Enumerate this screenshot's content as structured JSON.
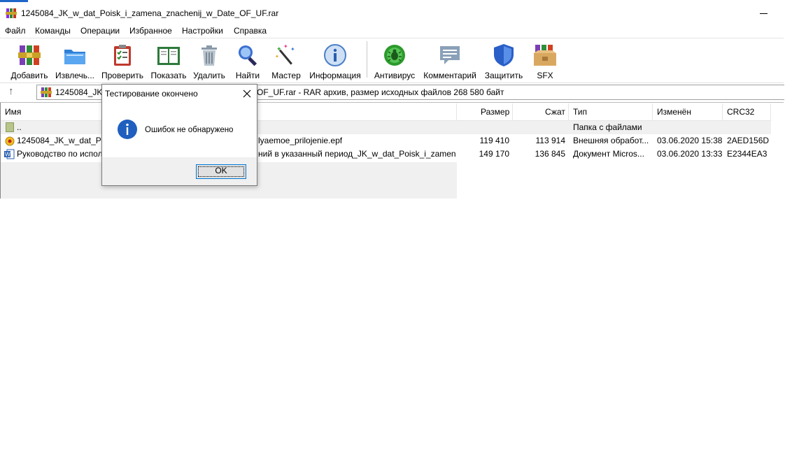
{
  "window": {
    "title": "1245084_JK_w_dat_Poisk_i_zamena_znachenij_w_Date_OF_UF.rar"
  },
  "menu": [
    {
      "label": "Файл"
    },
    {
      "label": "Команды"
    },
    {
      "label": "Операции"
    },
    {
      "label": "Избранное"
    },
    {
      "label": "Настройки"
    },
    {
      "label": "Справка"
    }
  ],
  "toolbar": [
    {
      "label": "Добавить",
      "icon": "rar-add-icon"
    },
    {
      "label": "Извлечь...",
      "icon": "folder-extract-icon"
    },
    {
      "label": "Проверить",
      "icon": "clipboard-test-icon"
    },
    {
      "label": "Показать",
      "icon": "book-view-icon"
    },
    {
      "label": "Удалить",
      "icon": "trash-icon"
    },
    {
      "label": "Найти",
      "icon": "magnifier-icon"
    },
    {
      "label": "Мастер",
      "icon": "wizard-wand-icon"
    },
    {
      "label": "Информация",
      "icon": "info-icon"
    },
    {
      "label": "Антивирус",
      "icon": "antivirus-bug-icon"
    },
    {
      "label": "Комментарий",
      "icon": "comment-icon"
    },
    {
      "label": "Защитить",
      "icon": "shield-icon"
    },
    {
      "label": "SFX",
      "icon": "sfx-box-icon"
    }
  ],
  "address": {
    "prefix": "1245084_JK_",
    "suffix": "OF_UF.rar - RAR архив, размер исходных файлов 268 580 байт"
  },
  "columns": {
    "name": "Имя",
    "size": "Размер",
    "packed": "Сжат",
    "type": "Тип",
    "modified": "Изменён",
    "crc": "CRC32"
  },
  "files": [
    {
      "name_left": "..",
      "name_right": "",
      "size": "",
      "packed": "",
      "type": "Папка с файлами",
      "modified": "",
      "crc": ""
    },
    {
      "name_left": "1245084_JK_w_dat_Pois",
      "name_right": "lyaemoe_prilojenie.epf",
      "size": "119 410",
      "packed": "113 914",
      "type": "Внешняя обработ...",
      "modified": "03.06.2020 15:38",
      "crc": "2AED156D"
    },
    {
      "name_left": "Руководство по испол",
      "name_right": "ний в указанный период_JK_w_dat_Poisk_i_zamena...",
      "size": "149 170",
      "packed": "136 845",
      "type": "Документ Micros...",
      "modified": "03.06.2020 13:33",
      "crc": "E2344EA3"
    }
  ],
  "dialog": {
    "title": "Тестирование окончено",
    "message": "Ошибок не обнаружено",
    "ok_label": "OK"
  }
}
